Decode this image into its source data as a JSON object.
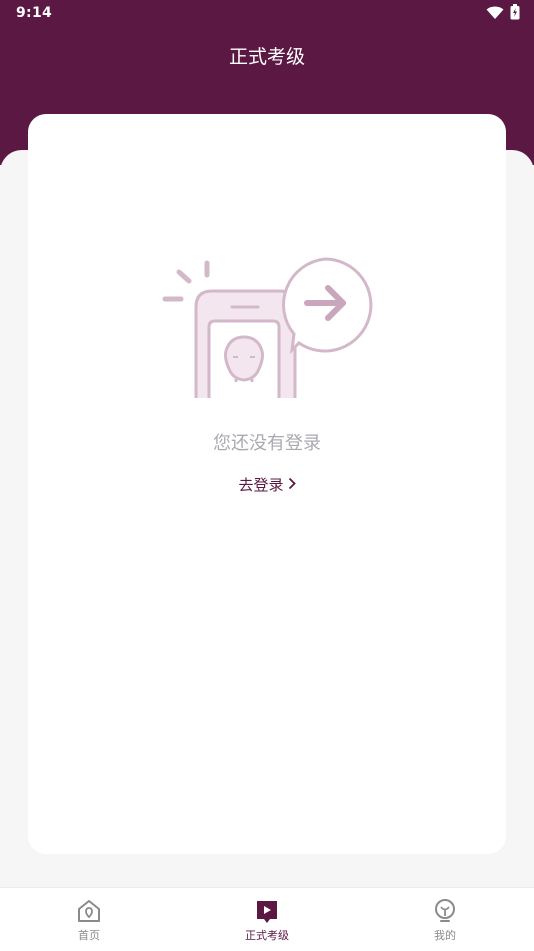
{
  "status_bar": {
    "time": "9:14"
  },
  "header": {
    "title": "正式考级"
  },
  "empty_state": {
    "message": "您还没有登录",
    "login_label": "去登录"
  },
  "bottom_nav": {
    "items": [
      {
        "label": "首页",
        "icon": "home-icon",
        "active": false
      },
      {
        "label": "正式考级",
        "icon": "exam-play-icon",
        "active": true
      },
      {
        "label": "我的",
        "icon": "lightbulb-icon",
        "active": false
      }
    ]
  },
  "colors": {
    "brand": "#5a1843",
    "background": "#f6f6f7",
    "muted_text": "#a9a9b1",
    "illustration": "#d9bfd0"
  }
}
